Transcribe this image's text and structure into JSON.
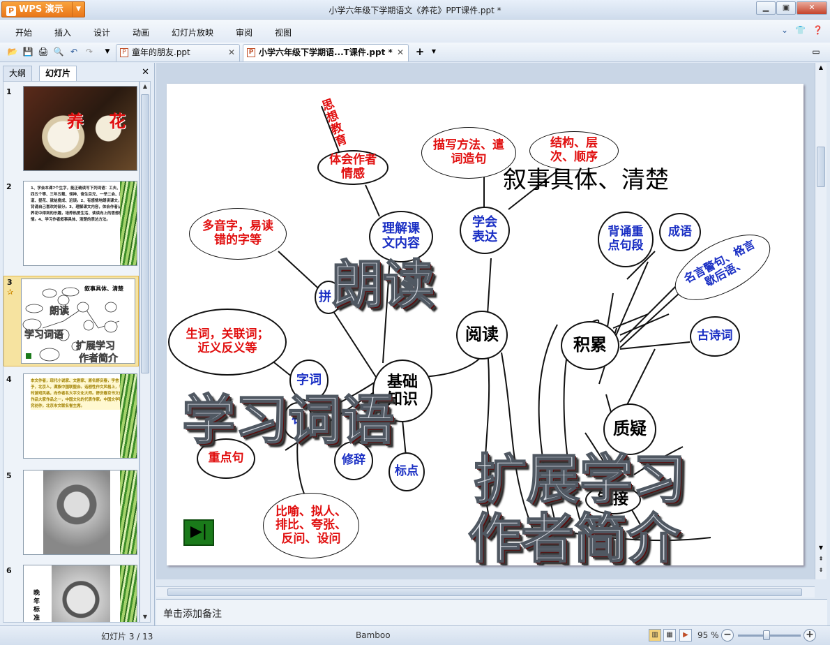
{
  "app": {
    "name": "WPS 演示",
    "window_title": "小学六年级下学期语文《养花》PPT课件.ppt *"
  },
  "menu": [
    "开始",
    "插入",
    "设计",
    "动画",
    "幻灯片放映",
    "审阅",
    "视图"
  ],
  "doc_tabs": [
    {
      "label": "童年的朋友.ppt"
    },
    {
      "label": "小学六年级下学期语...T课件.ppt *"
    }
  ],
  "left_panel": {
    "tabs": [
      "大纲",
      "幻灯片"
    ]
  },
  "slides": [
    {
      "num": "1",
      "title": "养 花"
    },
    {
      "num": "2",
      "text": "1、学会本课7个生字，能正确读写下列词语：工夫、四五个等、三年五载、领神、奋生目兄、一举二会、门道、昼花、就结度成、迟误。2、有感情地朗读课文，背诵自己喜欢的部分。3、理解课文内容，体会作者从养花中得到的乐趣，培养热爱生活、读读向上的思想感情。4、学习作者叙事具体、清楚的表达方法。"
    },
    {
      "num": "3"
    },
    {
      "num": "4",
      "text": "本文作者，现代小说家、文剧家、原名舒庆春，字舍予，北京人，满族中国联盟会。话剧性作文风格上，平时游戏风格，向作者名大字文化大师。舒庆春京书文创作品大家作品之一，中国文化的代表作家。中国文学研究创作，北京市文联名誉主席。"
    },
    {
      "num": "5"
    },
    {
      "num": "6",
      "text": "晚年标准像"
    }
  ],
  "mindmap": {
    "heading": "叙事具体、清楚",
    "nodes": {
      "sixiang": "思想教育",
      "tihui": "体会作者情感",
      "miaoxie": "描写方法、遣词造句",
      "jiegou": "结构、层次、顺序",
      "lijie": "理解课文内容",
      "xuehui": "学会表达",
      "beisong": "背诵重点句段",
      "chengyu": "成语",
      "mingyan": "名言警句、格言歇后语、",
      "duoyin": "多音字，易读错的字等",
      "pin": "拼",
      "yuedu": "阅读",
      "jilei": "积累",
      "gushi": "古诗词",
      "shengci": "生词，关联词；近义反义等",
      "ciyu": "字词",
      "jichu": "基础知识",
      "ju": "句",
      "zhiyi": "质疑",
      "zhongdian": "重点句",
      "xiuci": "修辞",
      "biaodian": "标点",
      "bianyu": "比喻、拟人、排比、夸张、反问、设问",
      "lianjie": "链接"
    },
    "wordart": {
      "langdu": "朗读",
      "xuexi": "学习词语",
      "kuozhan": "扩展学习",
      "zuozhe": "作者简介"
    }
  },
  "notes_placeholder": "单击添加备注",
  "status": {
    "slide_counter": "幻灯片 3 / 13",
    "theme": "Bamboo",
    "zoom": "95 %"
  }
}
